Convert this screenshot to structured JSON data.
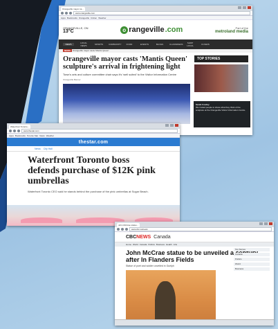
{
  "window1": {
    "tab_label": "Orangeville mayor ca...",
    "url": "www.orangeville.com",
    "bookmarks": [
      "Apps",
      "Bookmarks",
      "Orangeville",
      "Citizen",
      "Weather"
    ],
    "weather_label": "ORANGEVILLE, ON",
    "temperature": "13°C",
    "logo_prefix": "o",
    "logo_main": "rangeville",
    "logo_suffix": ".com",
    "partner_label": "Part of the",
    "partner_name": "metroland media",
    "nav_items": [
      "NEWS",
      "LOCAL NEWS",
      "SPORTS",
      "COMMUNITY",
      "FOOD",
      "EVENTS",
      "BLOGS",
      "CLASSIFIEDS",
      "SHOP LOCAL",
      "FLYERS"
    ],
    "breaking_tag": "NEWS",
    "breaking_text": "Orangeville mayor casts 'Mantis Queen'",
    "headline": "Orangeville mayor casts 'Mantis Queen' sculpture's arrival in frightening light",
    "dek": "Town's arts and culture committee chair says it's 'well suited' to the Visitor Information Centre",
    "byline": "Orangeville Banner",
    "top_stories_label": "TOP STORIES",
    "toast_name": "Sarah Cowley",
    "toast_text": "We invited people to share what they think of the sculpture at the Orangeville Visitor Information Centre."
  },
  "window2": {
    "tab_label": "Waterfront Toronto...",
    "url": "www.thestar.com",
    "bookmarks": [
      "Apps",
      "Bookmarks",
      "Toronto Star",
      "News",
      "Weather"
    ],
    "masthead": "thestar.com",
    "breadcrumb": [
      "News",
      "City Hall"
    ],
    "headline": "Waterfront Toronto boss defends purchase of $12K pink umbrellas",
    "dek": "Waterfront Toronto CEO said he stands behind the purchase of the pink umbrellas at Sugar Beach."
  },
  "window3": {
    "tab_label": "John McCrae statue...",
    "url": "www.cbc.ca/news",
    "logo_prefix": "CBC",
    "logo_suffix": "NEWS",
    "section": "Canada",
    "tabs": [
      "Home",
      "World",
      "Canada",
      "Politics",
      "Business",
      "Health",
      "Arts"
    ],
    "headline": "John McCrae statue to be unveiled a century after In Flanders Fields",
    "dek": "Statue of poet and soldier unveiled in Guelph",
    "sidebar": [
      "Top Stories",
      "Canada",
      "Politics",
      "World",
      "Business"
    ]
  }
}
